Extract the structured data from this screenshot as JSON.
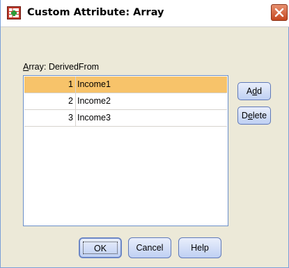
{
  "window": {
    "title": "Custom Attribute: Array",
    "icon": "data-editor-icon",
    "close_icon": "close-icon"
  },
  "array": {
    "label_prefix_ul": "A",
    "label_prefix_rest": "rray:",
    "name": "DerivedFrom"
  },
  "table": {
    "rows": [
      {
        "index": "1",
        "value": "Income1",
        "selected": true
      },
      {
        "index": "2",
        "value": "Income2",
        "selected": false
      },
      {
        "index": "3",
        "value": "Income3",
        "selected": false
      }
    ]
  },
  "side_buttons": {
    "add": {
      "pre": "A",
      "ul": "d",
      "post": "d"
    },
    "delete": {
      "pre": "D",
      "ul": "e",
      "post": "lete"
    }
  },
  "buttons": {
    "ok": "OK",
    "cancel": "Cancel",
    "help": "Help"
  },
  "colors": {
    "selected_row": "#f7c36a",
    "dialog_bg": "#ece9d8",
    "close_button": "#c5471f"
  }
}
